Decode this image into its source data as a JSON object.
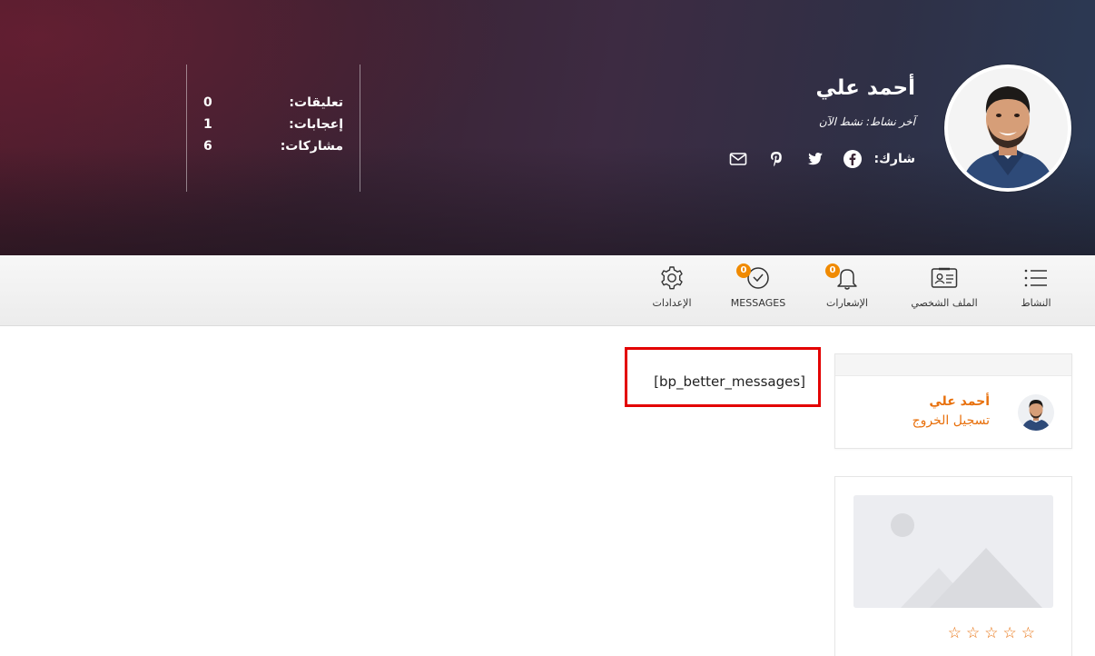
{
  "profile": {
    "name": "أحمد علي",
    "last_activity": "آخر نشاط: نشط الآن",
    "share_label": "شارك:",
    "share_icons": [
      "facebook-icon",
      "twitter-icon",
      "pinterest-icon",
      "envelope-icon"
    ],
    "stats": [
      {
        "label": "تعليقات:",
        "value": "0"
      },
      {
        "label": "إعجابات:",
        "value": "1"
      },
      {
        "label": "مشاركات:",
        "value": "6"
      }
    ]
  },
  "nav": {
    "items": [
      {
        "label": "النشاط",
        "icon": "list-icon"
      },
      {
        "label": "الملف الشخصي",
        "icon": "id-card-icon"
      },
      {
        "label": "الإشعارات",
        "icon": "bell-icon",
        "badge": "0"
      },
      {
        "label": "MESSAGES",
        "icon": "check-circle-icon",
        "badge": "0"
      },
      {
        "label": "الإعدادات",
        "icon": "gear-icon"
      }
    ]
  },
  "main": {
    "shortcode": "[bp_better_messages]"
  },
  "sidebar": {
    "login_widget": {
      "user_name": "أحمد علي",
      "logout_label": "تسجيل الخروج"
    },
    "product_widget": {
      "rating": 0,
      "max_rating": 5
    }
  },
  "colors": {
    "accent": "#e8700c",
    "badge": "#f08a00",
    "highlight_border": "#e30000"
  }
}
